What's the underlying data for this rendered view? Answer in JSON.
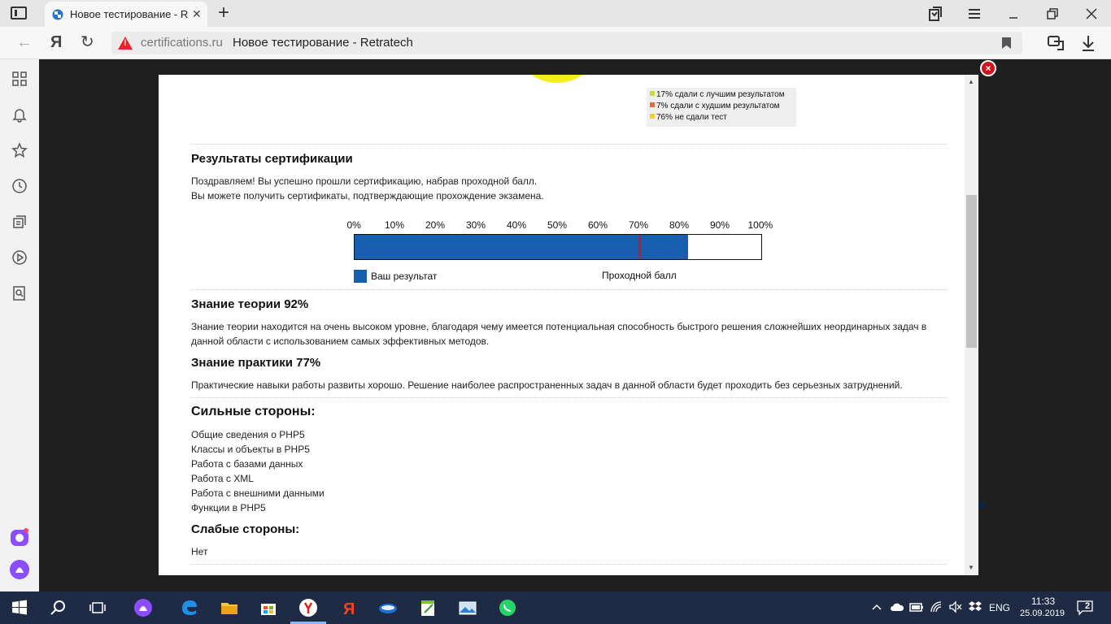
{
  "browser": {
    "tab_title": "Новое тестирование - R",
    "tab_close": "✕",
    "new_tab": "+",
    "url_domain": "certifications.ru",
    "page_title": "Новое тестирование - Retratech",
    "yandex_letter": "Я"
  },
  "modal": {
    "close_label": "×",
    "pie_legend": [
      {
        "text": "17% сдали с лучшим результатом",
        "color": "#c6d94f"
      },
      {
        "text": "7% сдали с худшим результатом",
        "color": "#e36e3b"
      },
      {
        "text": "76% не сдали тест",
        "color": "#f0d03a"
      }
    ],
    "results_heading": "Результаты сертификации",
    "results_text_1": "Поздравляем! Вы успешно прошли сертификацию, набрав проходной балл.",
    "results_text_2": "Вы можете получить сертификаты, подтверждающие прохождение экзамена.",
    "scale_ticks": [
      "0%",
      "10%",
      "20%",
      "30%",
      "40%",
      "50%",
      "60%",
      "70%",
      "80%",
      "90%",
      "100%"
    ],
    "your_result_label": "Ваш результат",
    "pass_score_label": "Проходной балл",
    "theory_heading": "Знание теории 92%",
    "theory_text": "Знание теории находится на очень высоком уровне, благодаря чему имеется потенциальная способность быстрого решения сложнейших неординарных задач в данной области с использованием самых эффективных методов.",
    "practice_heading": "Знание практики 77%",
    "practice_text": "Практические навыки работы развиты хорошо. Решение наиболее распространенных задач в данной области будет проходить без серьезных затруднений.",
    "strengths_heading": "Сильные стороны:",
    "strengths": [
      "Общие сведения о PHP5",
      "Классы и объекты в PHP5",
      "Работа с базами данных",
      "Работа с XML",
      "Работа с внешними данными",
      "Функции в PHP5"
    ],
    "weaknesses_heading": "Слабые стороны:",
    "weaknesses_text": "Нет"
  },
  "chart_data": {
    "type": "bar",
    "categories": [
      "Ваш результат"
    ],
    "values": [
      82
    ],
    "pass_score": 70,
    "xlim": [
      0,
      100
    ],
    "ticks": [
      "0%",
      "10%",
      "20%",
      "30%",
      "40%",
      "50%",
      "60%",
      "70%",
      "80%",
      "90%",
      "100%"
    ],
    "colors": {
      "result": "#175fae",
      "pass_line": "#c2151b"
    }
  },
  "taskbar": {
    "lang": "ENG",
    "time": "11:33",
    "date": "25.09.2019",
    "notifications": "2"
  }
}
